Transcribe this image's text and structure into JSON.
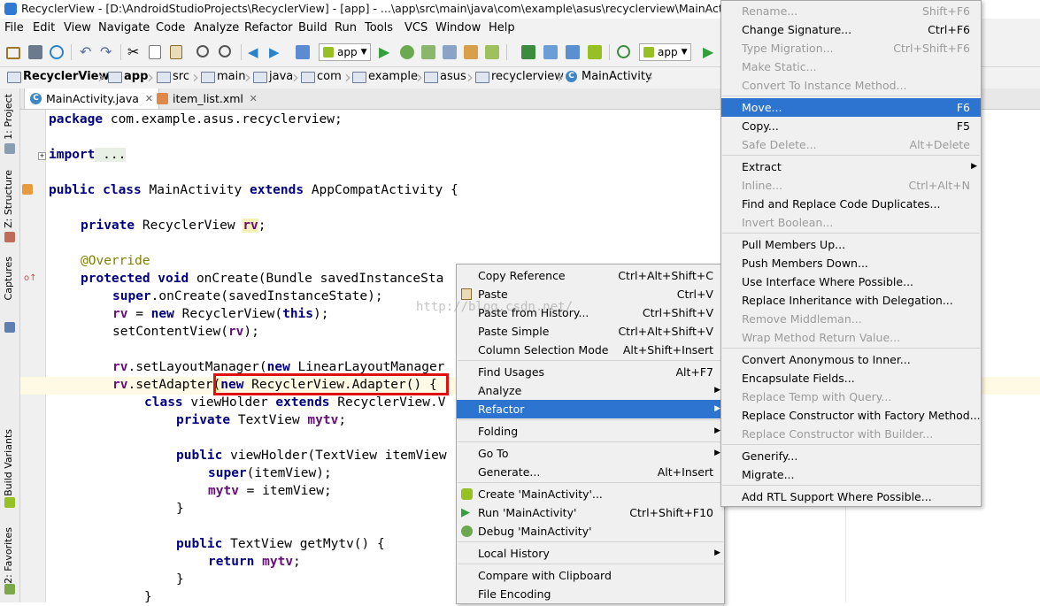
{
  "title_bar": {
    "text": "RecyclerView - [D:\\AndroidStudioProjects\\RecyclerView] - [app] - ...\\app\\src\\main\\java\\com\\example\\asus\\recyclerview\\MainActivity.java"
  },
  "menubar": {
    "items": [
      "File",
      "Edit",
      "View",
      "Navigate",
      "Code",
      "Analyze",
      "Refactor",
      "Build",
      "Run",
      "Tools",
      "VCS",
      "Window",
      "Help"
    ]
  },
  "toolbar": {
    "config1": "app",
    "config2": "app"
  },
  "breadcrumb": [
    "RecyclerView",
    "app",
    "src",
    "main",
    "java",
    "com",
    "example",
    "asus",
    "recyclerview",
    "MainActivity"
  ],
  "tabs": [
    {
      "label": "MainActivity.java",
      "icon": "C"
    },
    {
      "label": "item_list.xml",
      "icon": "xml"
    }
  ],
  "side_tabs": {
    "project": "1: Project",
    "structure": "Z: Structure",
    "captures": "Captures",
    "build_variants": "Build Variants",
    "favorites": "2: Favorites"
  },
  "code": {
    "l1_kw": "package",
    "l1": " com.example.asus.recyclerview;",
    "l2_kw": "import",
    "l2": " ...",
    "l3_kw": "public class",
    "l3a": " MainActivity ",
    "l3_kw2": "extends",
    "l3b": " AppCompatActivity {",
    "l4_kw": "private",
    "l4a": " RecyclerView ",
    "l4_f": "rv",
    "l4b": ";",
    "l5": "@Override",
    "l6_kw": "protected void",
    "l6": " onCreate(Bundle savedInstanceSta",
    "l7_kw": "super",
    "l7": ".onCreate(savedInstanceState);",
    "l8_f": "rv",
    "l8a": " = ",
    "l8_kw": "new",
    "l8b": " RecyclerView(",
    "l8_kw2": "this",
    "l8c": ");",
    "l9": "setContentView(",
    "l9_f": "rv",
    "l9b": ");",
    "l10_f": "rv",
    "l10a": ".setLayoutManager(",
    "l10_kw": "new",
    "l10b": " LinearLayoutManager",
    "l11_f": "rv",
    "l11a": ".setAdapter",
    "l11b": "(",
    "l11_kw": "new",
    "l11c": " RecyclerView.Adapter() {",
    "l12_kw": "class",
    "l12a": " viewHolder ",
    "l12_kw2": "extends",
    "l12b": " RecyclerView.V",
    "l13_kw": "private",
    "l13a": " TextView ",
    "l13_f": "mytv",
    "l13b": ";",
    "l14_kw": "public",
    "l14": " viewHolder(TextView itemView",
    "l15_kw": "super",
    "l15": "(itemView);",
    "l16_f": "mytv",
    "l16": " = itemView;",
    "l17": "}",
    "l18_kw": "public",
    "l18": " TextView getMytv() {",
    "l19_kw": "return",
    "l19_f": "mytv",
    "l19b": ";",
    "l20": "}",
    "l21": "}"
  },
  "watermark": "http://blog.csdn.net/",
  "context_menu": {
    "items": [
      {
        "label": "Copy Reference",
        "shortcut": "Ctrl+Alt+Shift+C"
      },
      {
        "label": "Paste",
        "shortcut": "Ctrl+V",
        "icon": "paste-icon"
      },
      {
        "label": "Paste from History...",
        "shortcut": "Ctrl+Shift+V"
      },
      {
        "label": "Paste Simple",
        "shortcut": "Ctrl+Alt+Shift+V"
      },
      {
        "label": "Column Selection Mode",
        "shortcut": "Alt+Shift+Insert"
      },
      {
        "label": "Find Usages",
        "shortcut": "Alt+F7"
      },
      {
        "label": "Analyze",
        "shortcut": ""
      },
      {
        "label": "Refactor",
        "shortcut": ""
      },
      {
        "label": "Folding",
        "shortcut": ""
      },
      {
        "label": "Go To",
        "shortcut": ""
      },
      {
        "label": "Generate...",
        "shortcut": "Alt+Insert"
      },
      {
        "label": "Create 'MainActivity'...",
        "shortcut": "",
        "icon": "android-icon"
      },
      {
        "label": "Run 'MainActivity'",
        "shortcut": "Ctrl+Shift+F10",
        "icon": "run-icon"
      },
      {
        "label": "Debug 'MainActivity'",
        "shortcut": "",
        "icon": "debug-icon"
      },
      {
        "label": "Local History",
        "shortcut": ""
      },
      {
        "label": "Compare with Clipboard",
        "shortcut": ""
      },
      {
        "label": "File Encoding",
        "shortcut": ""
      }
    ]
  },
  "refactor_menu": {
    "items": [
      {
        "label": "Rename...",
        "shortcut": "Shift+F6"
      },
      {
        "label": "Change Signature...",
        "shortcut": "Ctrl+F6"
      },
      {
        "label": "Type Migration...",
        "shortcut": "Ctrl+Shift+F6"
      },
      {
        "label": "Make Static...",
        "shortcut": ""
      },
      {
        "label": "Convert To Instance Method...",
        "shortcut": ""
      },
      {
        "label": "Move...",
        "shortcut": "F6"
      },
      {
        "label": "Copy...",
        "shortcut": "F5"
      },
      {
        "label": "Safe Delete...",
        "shortcut": "Alt+Delete"
      },
      {
        "label": "Extract",
        "shortcut": ""
      },
      {
        "label": "Inline...",
        "shortcut": "Ctrl+Alt+N"
      },
      {
        "label": "Find and Replace Code Duplicates...",
        "shortcut": ""
      },
      {
        "label": "Invert Boolean...",
        "shortcut": ""
      },
      {
        "label": "Pull Members Up...",
        "shortcut": ""
      },
      {
        "label": "Push Members Down...",
        "shortcut": ""
      },
      {
        "label": "Use Interface Where Possible...",
        "shortcut": ""
      },
      {
        "label": "Replace Inheritance with Delegation...",
        "shortcut": ""
      },
      {
        "label": "Remove Middleman...",
        "shortcut": ""
      },
      {
        "label": "Wrap Method Return Value...",
        "shortcut": ""
      },
      {
        "label": "Convert Anonymous to Inner...",
        "shortcut": ""
      },
      {
        "label": "Encapsulate Fields...",
        "shortcut": ""
      },
      {
        "label": "Replace Temp with Query...",
        "shortcut": ""
      },
      {
        "label": "Replace Constructor with Factory Method...",
        "shortcut": ""
      },
      {
        "label": "Replace Constructor with Builder...",
        "shortcut": ""
      },
      {
        "label": "Generify...",
        "shortcut": ""
      },
      {
        "label": "Migrate...",
        "shortcut": ""
      },
      {
        "label": "Add RTL Support Where Possible...",
        "shortcut": ""
      }
    ]
  },
  "colors": {
    "selection": "#2d73d0",
    "keyword": "#000080",
    "field": "#660e7a",
    "annotation": "#808000",
    "highlight_box": "#e01010"
  }
}
